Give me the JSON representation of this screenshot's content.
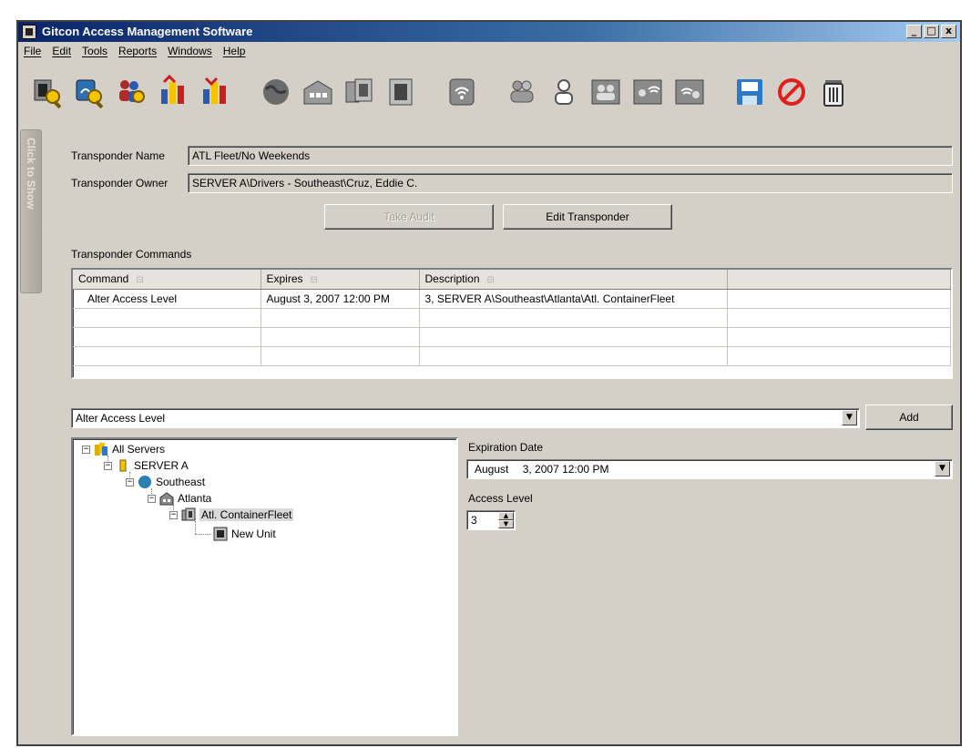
{
  "window": {
    "title": "Gitcon Access Management Software",
    "controls": [
      "_",
      "□",
      "x"
    ]
  },
  "menu": [
    "File",
    "Edit",
    "Tools",
    "Reports",
    "Windows",
    "Help"
  ],
  "toolbar_icons": [
    "find-transponder-icon",
    "transponder-audit-icon",
    "find-user-icon",
    "report-icon",
    "report-alt-icon",
    "globe-icon",
    "building-icon",
    "container-fleet-icon",
    "unit-icon",
    "wireless-transponder-icon",
    "user-group-icon",
    "user-icon",
    "group-icon",
    "group-wireless-icon",
    "group-wireless-alt-icon",
    "save-icon",
    "cancel-icon",
    "delete-icon"
  ],
  "side_tab": {
    "label": "Click to Show"
  },
  "transponder": {
    "name_label": "Transponder Name",
    "name_value": "ATL Fleet/No Weekends",
    "owner_label": "Transponder Owner",
    "owner_value": "SERVER A\\Drivers - Southeast\\Cruz, Eddie  C."
  },
  "buttons": {
    "take_audit": "Take Audit",
    "edit_transponder": "Edit Transponder",
    "add": "Add"
  },
  "commands": {
    "section_label": "Transponder Commands",
    "columns": [
      "Command",
      "Expires",
      "Description",
      ""
    ],
    "rows": [
      [
        "Alter Access Level",
        "August 3, 2007 12:00 PM",
        "3, SERVER A\\Southeast\\Atlanta\\Atl. ContainerFleet",
        ""
      ],
      [
        "",
        "",
        "",
        ""
      ],
      [
        "",
        "",
        "",
        ""
      ],
      [
        "",
        "",
        "",
        ""
      ]
    ]
  },
  "command_select": {
    "value": "Alter Access Level"
  },
  "tree": {
    "nodes": [
      {
        "label": "All Servers",
        "icon": "all-servers-icon"
      },
      {
        "label": "SERVER A",
        "icon": "server-icon"
      },
      {
        "label": "Southeast",
        "icon": "globe-icon"
      },
      {
        "label": "Atlanta",
        "icon": "building-icon"
      },
      {
        "label": "Atl. ContainerFleet",
        "icon": "container-fleet-icon",
        "selected": true
      },
      {
        "label": "New Unit",
        "icon": "unit-icon"
      }
    ]
  },
  "expiration": {
    "label": "Expiration Date",
    "month": "August",
    "date_time": "3, 2007 12:00 PM"
  },
  "access_level": {
    "label": "Access Level",
    "value": "3"
  }
}
